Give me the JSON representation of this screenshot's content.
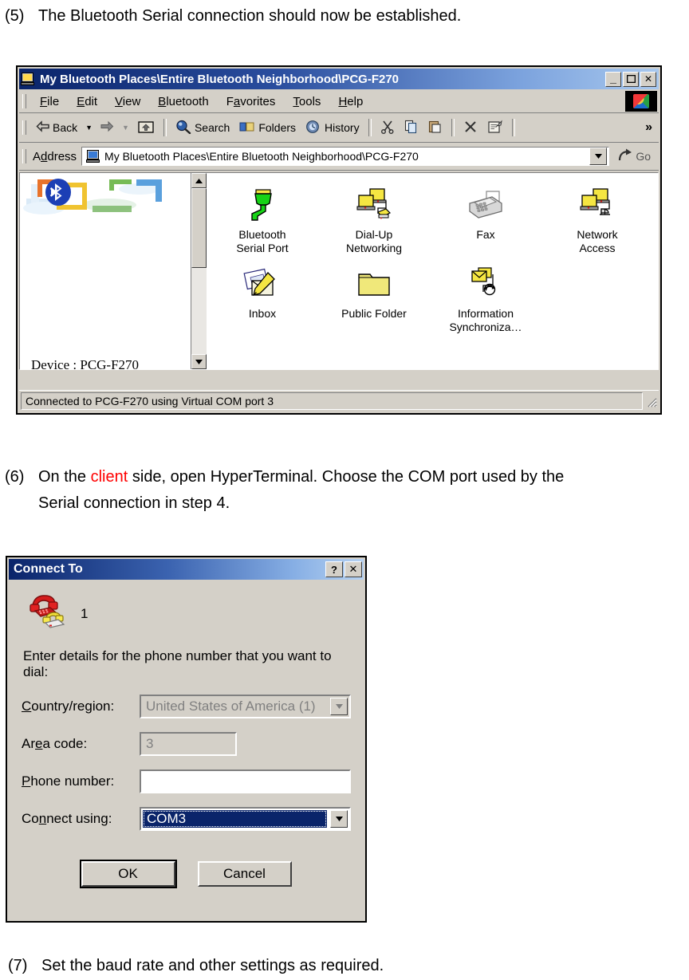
{
  "steps": {
    "step5": {
      "num": "(5)",
      "text": "The Bluetooth Serial connection should now be established."
    },
    "step6_line1_a": "On the ",
    "step6_highlight": "client",
    "step6_line1_b": " side, open HyperTerminal. Choose the COM port used by the",
    "step6_num": "(6)",
    "step6_line2": "Serial connection in step 4.",
    "step7": {
      "num": "(7)",
      "text": "Set the baud rate and other settings as required."
    }
  },
  "colors": {
    "highlight_red": "#ff0000",
    "titlebar_start": "#0a246a",
    "titlebar_end": "#a8c8ee",
    "face": "#d4d0c8",
    "selection": "#0a246a"
  },
  "explorer": {
    "title": "My Bluetooth Places\\Entire Bluetooth Neighborhood\\PCG-F270",
    "window_buttons": {
      "minimize": "_",
      "maximize": "□",
      "close": "✕"
    },
    "menu": [
      "File",
      "Edit",
      "View",
      "Bluetooth",
      "Favorites",
      "Tools",
      "Help"
    ],
    "toolbar": {
      "back": "Back",
      "forward": "",
      "up": "",
      "search": "Search",
      "folders": "Folders",
      "history": "History",
      "cut": "",
      "copy": "",
      "paste": "",
      "delete": "",
      "properties": "",
      "overflow": "»"
    },
    "address": {
      "label": "Address",
      "value": "My Bluetooth Places\\Entire Bluetooth Neighborhood\\PCG-F270",
      "go_label": "Go"
    },
    "left_pane": {
      "device_label": "Device : PCG-F270"
    },
    "items": [
      {
        "name": "Bluetooth Serial Port",
        "line1": "Bluetooth",
        "line2": "Serial Port",
        "icon": "serial-port-icon"
      },
      {
        "name": "Dial-Up Networking",
        "line1": "Dial-Up",
        "line2": "Networking",
        "icon": "dialup-networking-icon"
      },
      {
        "name": "Fax",
        "line1": "Fax",
        "line2": "",
        "icon": "fax-icon"
      },
      {
        "name": "Network Access",
        "line1": "Network",
        "line2": "Access",
        "icon": "network-access-icon"
      },
      {
        "name": "Inbox",
        "line1": "Inbox",
        "line2": "",
        "icon": "inbox-icon"
      },
      {
        "name": "Public Folder",
        "line1": "Public Folder",
        "line2": "",
        "icon": "folder-icon"
      },
      {
        "name": "Information Synchronization",
        "line1": "Information",
        "line2": "Synchroniza…",
        "icon": "info-sync-icon"
      }
    ],
    "status": "Connected to PCG-F270 using Virtual COM port 3"
  },
  "dialog": {
    "title": "Connect To",
    "help_button": "?",
    "close_button": "✕",
    "connection_name": "1",
    "intro": "Enter details for the phone number that you want to dial:",
    "fields": [
      {
        "label": "Country/region:",
        "value": "United States of America (1)",
        "enabled": false,
        "type": "combo"
      },
      {
        "label": "Area code:",
        "value": "3",
        "enabled": false,
        "type": "text"
      },
      {
        "label": "Phone number:",
        "value": "",
        "enabled": true,
        "type": "text"
      },
      {
        "label": "Connect using:",
        "value": "COM3",
        "enabled": true,
        "type": "combo-selected"
      }
    ],
    "buttons": {
      "ok": "OK",
      "cancel": "Cancel"
    }
  }
}
